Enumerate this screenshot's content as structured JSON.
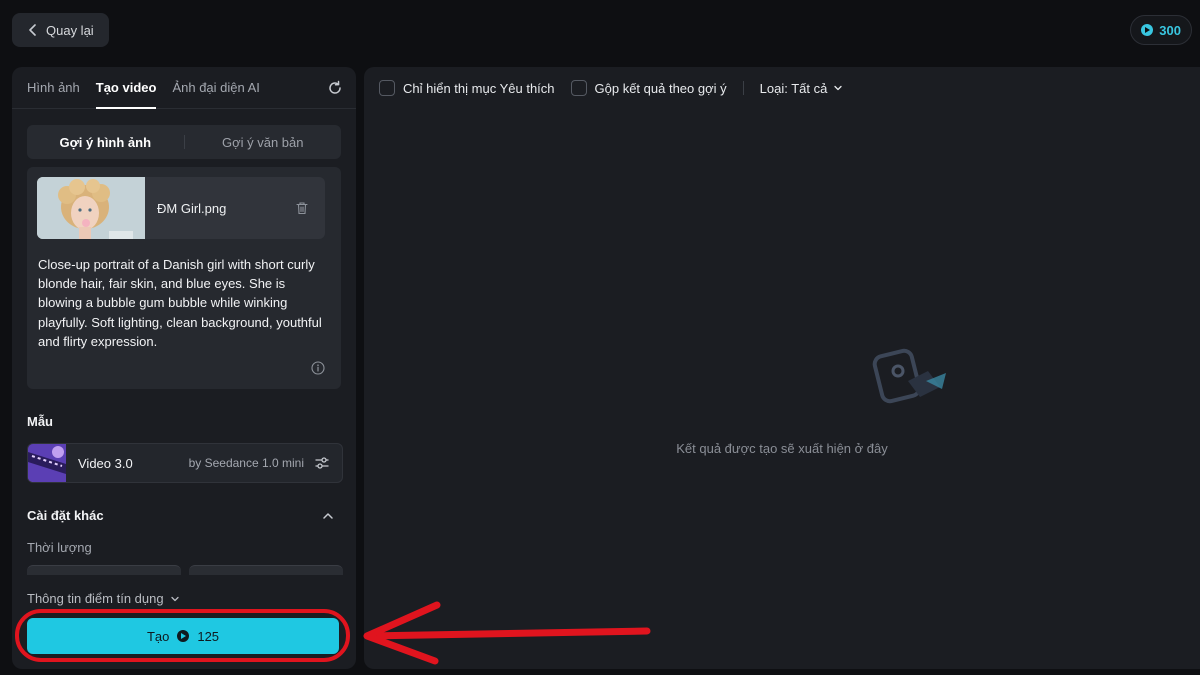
{
  "header": {
    "back_label": "Quay lại",
    "credits": "300"
  },
  "left_panel": {
    "tabs": [
      {
        "label": "Hình ảnh",
        "active": false
      },
      {
        "label": "Tạo video",
        "active": true
      },
      {
        "label": "Ảnh đại diện AI",
        "active": false
      }
    ],
    "segments": [
      {
        "label": "Gợi ý hình ảnh",
        "active": true
      },
      {
        "label": "Gợi ý văn bản",
        "active": false
      }
    ],
    "file": {
      "name": "ĐM Girl.png"
    },
    "prompt": "Close-up portrait of a Danish girl with short curly blonde hair, fair skin, and blue eyes. She is blowing a bubble gum bubble while winking playfully. Soft lighting, clean background, youthful and flirty expression.",
    "model_section_title": "Mẫu",
    "model": {
      "name": "Video 3.0",
      "provider": "by Seedance 1.0 mini"
    },
    "other_settings_title": "Cài đặt khác",
    "duration_label": "Thời lượng",
    "credit_info_label": "Thông tin điểm tín dụng",
    "create_button": {
      "label": "Tạo",
      "cost": "125"
    }
  },
  "right_panel": {
    "filters": {
      "favorites_label": "Chỉ hiển thị mục Yêu thích",
      "group_label": "Gộp kết quả theo gợi ý",
      "type_label": "Loại: Tất cả"
    },
    "empty_message": "Kết quả được tạo sẽ xuất hiện ở đây"
  },
  "colors": {
    "accent": "#1fc8e2",
    "highlight": "#e0141e",
    "background": "#0e0f12",
    "panel": "#1b1d22"
  }
}
